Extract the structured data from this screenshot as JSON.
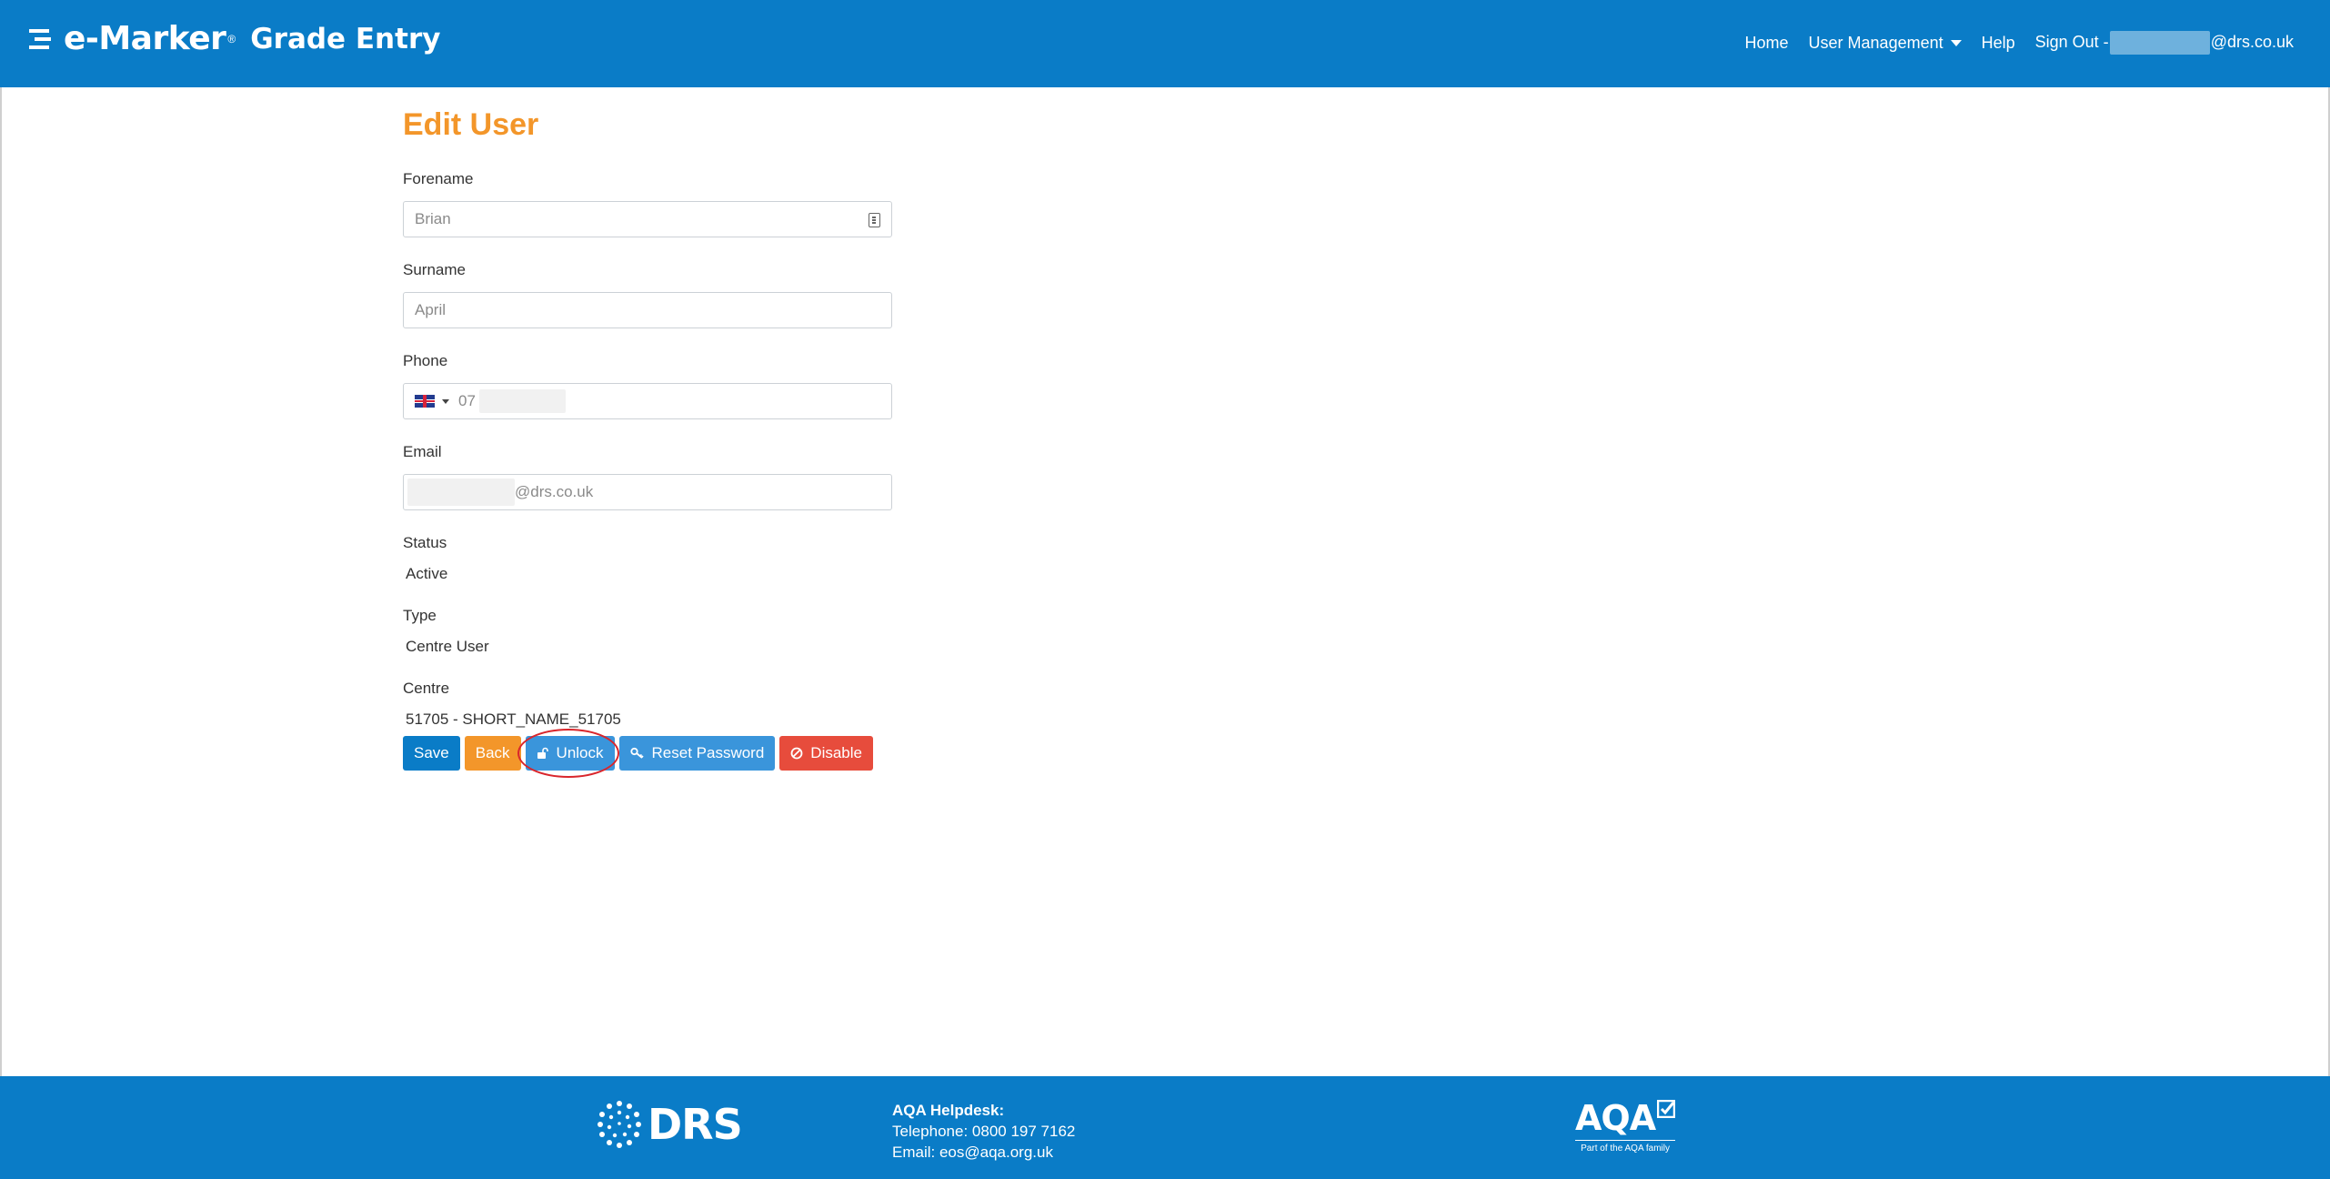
{
  "header": {
    "brand_name": "e-Marker",
    "brand_reg": "®",
    "brand_subtitle": "Grade Entry",
    "nav": {
      "home": "Home",
      "user_management": "User Management",
      "help": "Help",
      "sign_out_prefix": "Sign Out -",
      "sign_out_domain": "@drs.co.uk"
    }
  },
  "page": {
    "title": "Edit User"
  },
  "form": {
    "forename": {
      "label": "Forename",
      "value": "Brian"
    },
    "surname": {
      "label": "Surname",
      "value": "April"
    },
    "phone": {
      "label": "Phone",
      "value": "07"
    },
    "email": {
      "label": "Email",
      "value": "@drs.co.uk"
    },
    "status": {
      "label": "Status",
      "value": "Active"
    },
    "type": {
      "label": "Type",
      "value": "Centre User"
    },
    "centre": {
      "label": "Centre",
      "value": "51705 - SHORT_NAME_51705"
    }
  },
  "buttons": {
    "save": "Save",
    "back": "Back",
    "unlock": "Unlock",
    "reset_password": "Reset Password",
    "disable": "Disable"
  },
  "footer": {
    "drs_logo": "DRS",
    "helpdesk_title": "AQA Helpdesk:",
    "telephone": "Telephone: 0800 197 7162",
    "email": "Email: eos@aqa.org.uk",
    "aqa_logo": "AQA",
    "aqa_tagline": "Part of the AQA family"
  },
  "colors": {
    "header_bg": "#0a7cc7",
    "title_orange": "#f3962a",
    "unlock_blue": "#3a95db",
    "disable_red": "#e74c3c",
    "highlight_ring": "#d9262c"
  },
  "icons": {
    "unlock": "unlock-icon",
    "reset_password": "key-icon",
    "disable": "ban-icon",
    "forename_field": "contact-card-icon",
    "phone_country": "uk-flag-icon"
  }
}
